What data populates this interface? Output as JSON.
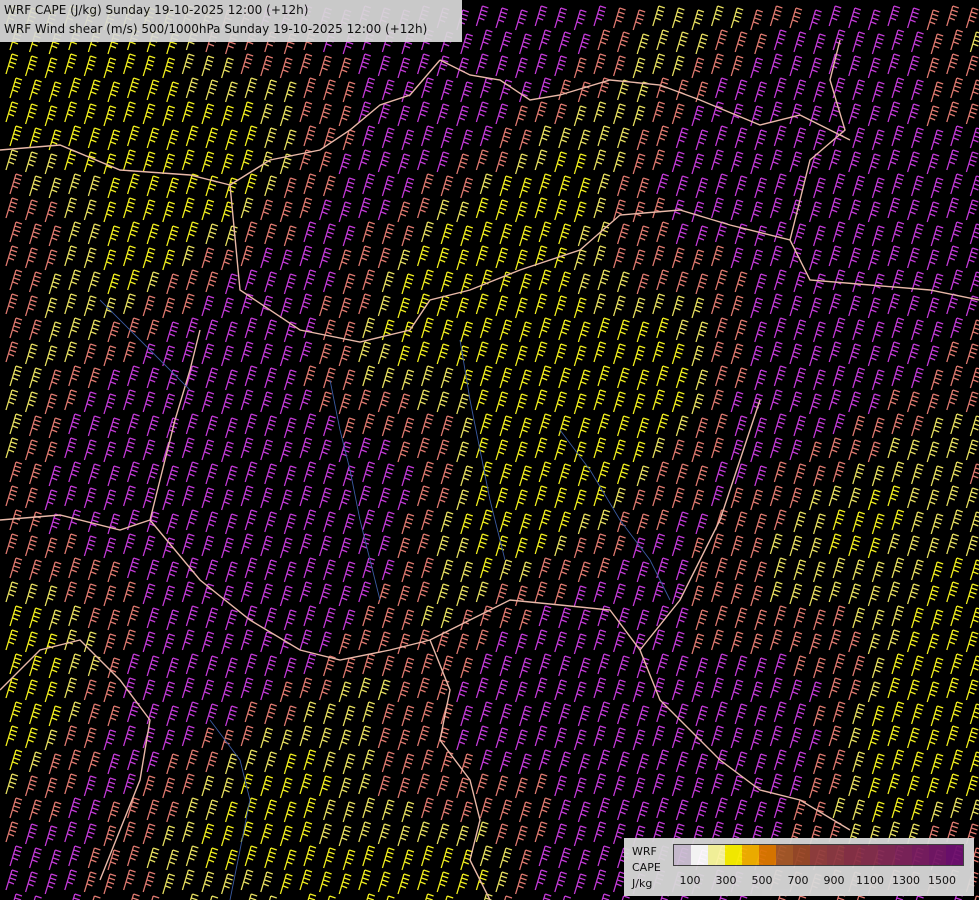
{
  "title": {
    "line1": "WRF CAPE (J/kg) Sunday 19-10-2025 12:00 (+12h)",
    "line2": "WRF Wind shear (m/s) 500/1000hPa Sunday 19-10-2025 12:00 (+12h)"
  },
  "legend": {
    "label1": "WRF",
    "label2": "CAPE",
    "label3": "J/kg",
    "colors": [
      "#cfc2d6",
      "#ffffff",
      "#fdfba0",
      "#fdf400",
      "#f7b400",
      "#e07a00",
      "#a85a2a",
      "#9a4a2a",
      "#944040",
      "#8e3a44",
      "#8a3248",
      "#86304e",
      "#822a56",
      "#7e245c",
      "#7a1e62",
      "#741868",
      "#6e1070"
    ],
    "tick_labels": [
      "100",
      "300",
      "500",
      "700",
      "900",
      "1100",
      "1300",
      "1500"
    ]
  },
  "map_colors": {
    "background": "#000000",
    "barb_purple": "#c43ad8",
    "barb_salmon": "#e07a70",
    "barb_yellow": "#f2f01e",
    "barb_pale_yellow": "#e8e060",
    "border": "#e8b8a8",
    "river": "#3a5aa0"
  }
}
